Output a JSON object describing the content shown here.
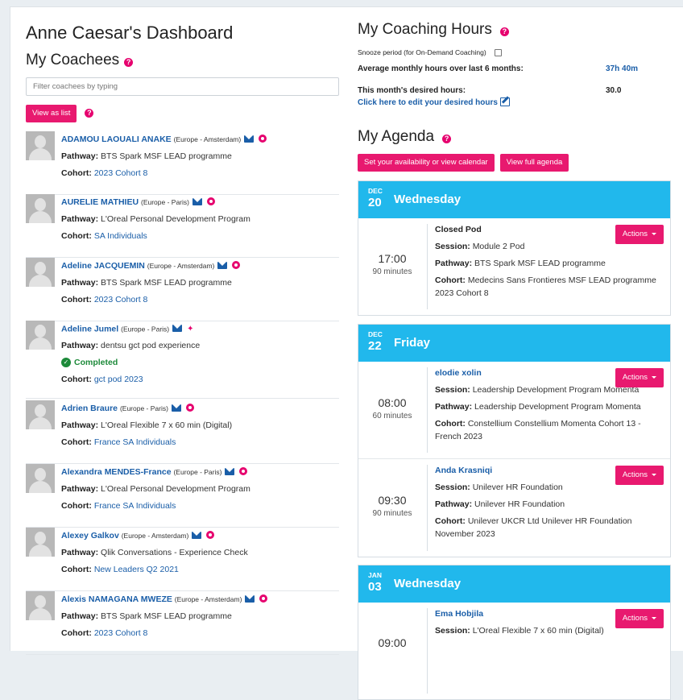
{
  "dashboard": {
    "title": "Anne Caesar's Dashboard"
  },
  "coachees": {
    "heading": "My Coachees",
    "filter_placeholder": "Filter coachees by typing",
    "view_as_list": "View as list",
    "items": [
      {
        "name": "ADAMOU LAOUALI ANAKE",
        "location": "(Europe - Amsterdam)",
        "pathway_label": "Pathway:",
        "pathway": "BTS Spark MSF LEAD programme",
        "cohort_label": "Cohort:",
        "cohort": "2023 Cohort 8",
        "icon": "target-icon"
      },
      {
        "name": "AURELIE MATHIEU",
        "location": "(Europe - Paris)",
        "pathway_label": "Pathway:",
        "pathway": "L'Oreal Personal Development Program",
        "cohort_label": "Cohort:",
        "cohort": "SA Individuals",
        "icon": "target-icon"
      },
      {
        "name": "Adeline JACQUEMIN",
        "location": "(Europe - Amsterdam)",
        "pathway_label": "Pathway:",
        "pathway": "BTS Spark MSF LEAD programme",
        "cohort_label": "Cohort:",
        "cohort": "2023 Cohort 8",
        "icon": "target-icon"
      },
      {
        "name": "Adeline Jumel",
        "location": "(Europe - Paris)",
        "pathway_label": "Pathway:",
        "pathway": "dentsu gct pod experience",
        "status": "Completed",
        "cohort_label": "Cohort:",
        "cohort": "gct pod 2023",
        "icon": "pin-icon"
      },
      {
        "name": "Adrien Braure",
        "location": "(Europe - Paris)",
        "pathway_label": "Pathway:",
        "pathway": "L'Oreal Flexible 7 x 60 min (Digital)",
        "cohort_label": "Cohort:",
        "cohort": "France SA Individuals",
        "icon": "target-icon"
      },
      {
        "name": "Alexandra MENDES-France",
        "location": "(Europe - Paris)",
        "pathway_label": "Pathway:",
        "pathway": "L'Oreal Personal Development Program",
        "cohort_label": "Cohort:",
        "cohort": "France SA Individuals",
        "icon": "target-icon"
      },
      {
        "name": "Alexey Galkov",
        "location": "(Europe - Amsterdam)",
        "pathway_label": "Pathway:",
        "pathway": "Qlik Conversations - Experience Check",
        "cohort_label": "Cohort:",
        "cohort": "New Leaders Q2 2021",
        "icon": "target-icon"
      },
      {
        "name": "Alexis NAMAGANA MWEZE",
        "location": "(Europe - Amsterdam)",
        "pathway_label": "Pathway:",
        "pathway": "BTS Spark MSF LEAD programme",
        "cohort_label": "Cohort:",
        "cohort": "2023 Cohort 8",
        "icon": "target-icon"
      }
    ]
  },
  "hours": {
    "heading": "My Coaching Hours",
    "snooze_label": "Snooze period (for On-Demand Coaching)",
    "avg_label": "Average monthly hours over last 6 months:",
    "avg_value": "37h 40m",
    "desired_label": "This month's desired hours:",
    "desired_value": "30.0",
    "edit_link": "Click here to edit your desired hours"
  },
  "agenda": {
    "heading": "My Agenda",
    "availability_button": "Set your availability or view calendar",
    "full_agenda_button": "View full agenda",
    "days": [
      {
        "month": "DEC",
        "day": "20",
        "weekday": "Wednesday",
        "events": [
          {
            "time": "17:00",
            "duration": "90 minutes",
            "title": "Closed Pod",
            "title_link": false,
            "session_label": "Session:",
            "session": "Module 2 Pod",
            "pathway_label": "Pathway:",
            "pathway": "BTS Spark MSF LEAD programme",
            "cohort_label": "Cohort:",
            "cohort": "Medecins Sans Frontieres MSF LEAD programme 2023 Cohort 8",
            "actions": "Actions"
          }
        ]
      },
      {
        "month": "DEC",
        "day": "22",
        "weekday": "Friday",
        "events": [
          {
            "time": "08:00",
            "duration": "60 minutes",
            "title": "elodie xolin",
            "title_link": true,
            "session_label": "Session:",
            "session": "Leadership Development Program Momenta",
            "pathway_label": "Pathway:",
            "pathway": "Leadership Development Program Momenta",
            "cohort_label": "Cohort:",
            "cohort": "Constellium Constellium Momenta Cohort 13 - French 2023",
            "actions": "Actions"
          },
          {
            "time": "09:30",
            "duration": "90 minutes",
            "title": "Anda Krasniqi",
            "title_link": true,
            "session_label": "Session:",
            "session": "Unilever HR Foundation",
            "pathway_label": "Pathway:",
            "pathway": "Unilever HR Foundation",
            "cohort_label": "Cohort:",
            "cohort": "Unilever UKCR Ltd Unilever HR Foundation November 2023",
            "actions": "Actions"
          }
        ]
      },
      {
        "month": "JAN",
        "day": "03",
        "weekday": "Wednesday",
        "events": [
          {
            "time": "09:00",
            "duration": "",
            "title": "Ema Hobjila",
            "title_link": true,
            "session_label": "Session:",
            "session": "L'Oreal Flexible 7 x 60 min (Digital)",
            "actions": "Actions"
          }
        ]
      }
    ]
  },
  "colors": {
    "accent": "#e8196f",
    "link": "#1a5ea8",
    "day_header": "#21b8ec",
    "completed": "#1d8a3a"
  }
}
